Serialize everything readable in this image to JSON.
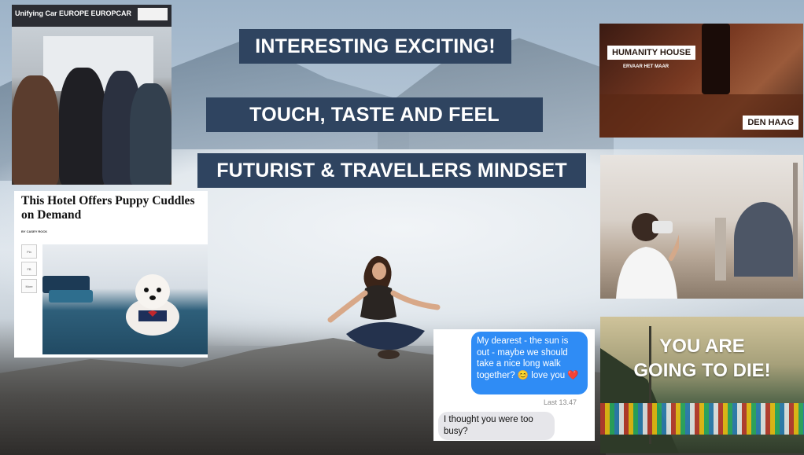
{
  "banners": {
    "line1": "INTERESTING EXCITING!",
    "line2": "TOUCH, TASTE AND FEEL",
    "line3": "FUTURIST & TRAVELLERS MINDSET"
  },
  "airport": {
    "sign_text": "Unifying Car  EUROPE  EUROPCAR"
  },
  "hotel_article": {
    "headline": "This Hotel Offers Puppy Cuddles on Demand",
    "byline": "BY CASEY ROCK",
    "share_buttons": [
      "Pin",
      "FB",
      "More"
    ]
  },
  "humanity_house": {
    "name": "HUMANITY HOUSE",
    "tagline": "ERVAAR HET MAAR",
    "city": "DEN HAAG"
  },
  "die_poster": {
    "line1": "YOU ARE",
    "line2": "GOING TO DIE!"
  },
  "chat": {
    "outgoing": "My dearest - the sun is out - maybe we should take a nice long walk together? 😊 love you ❤️",
    "timestamp": "Last 13.47",
    "incoming": "I thought you were too busy?",
    "outgoing_color": "#2f8cf5",
    "incoming_color": "#e6e6ea"
  },
  "theme": {
    "banner_color": "#2f4460"
  }
}
